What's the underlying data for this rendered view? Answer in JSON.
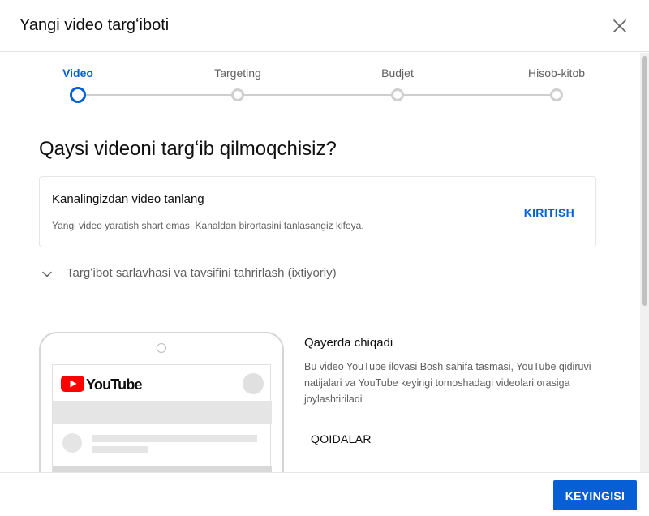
{
  "dialog": {
    "title": "Yangi video targʻiboti"
  },
  "stepper": {
    "steps": [
      {
        "label": "Video",
        "active": true
      },
      {
        "label": "Targeting",
        "active": false
      },
      {
        "label": "Budjet",
        "active": false
      },
      {
        "label": "Hisob-kitob",
        "active": false
      }
    ]
  },
  "main": {
    "title": "Qaysi videoni targʻib qilmoqchisiz?",
    "select_card": {
      "title": "Kanalingizdan video tanlang",
      "subtitle": "Yangi video yaratish shart emas. Kanaldan birortasini tanlasangiz kifoya.",
      "action_label": "KIRITISH"
    },
    "expander_label": "Targʻibot sarlavhasi va tavsifini tahrirlash (ixtiyoriy)",
    "preview": {
      "logo_text": "YouTube"
    },
    "placement": {
      "title": "Qayerda chiqadi",
      "description": "Bu video YouTube ilovasi Bosh sahifa tasmasi, YouTube qidiruvi natijalari va YouTube keyingi tomoshadagi videolari orasiga joylashtiriladi",
      "rules_label": "QOIDALAR"
    }
  },
  "footer": {
    "next_label": "KEYINGISI"
  },
  "colors": {
    "accent": "#065fd4",
    "youtube_red": "#ff0000"
  },
  "icons": {
    "close": "close-icon",
    "expand": "chevron-down-icon",
    "logo": "youtube-logo-icon"
  }
}
